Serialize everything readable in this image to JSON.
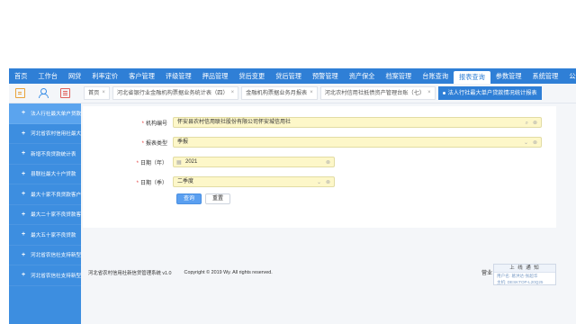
{
  "topnav": {
    "items": [
      "首页",
      "工作台",
      "网贷",
      "利率定价",
      "客户管理",
      "评级管理",
      "押品管理",
      "贷后变更",
      "贷后管理",
      "预警管理",
      "资产保全",
      "档案管理",
      "台账查询",
      "报表查询",
      "参数管理",
      "系统管理",
      "公示事项"
    ],
    "active_label": "报表查询"
  },
  "iconbar": {
    "icons": [
      "document-icon",
      "user-icon",
      "list-icon"
    ]
  },
  "tabs": [
    {
      "label": "首页"
    },
    {
      "label": "河北省银行业金融机构票据业务统计表（四）"
    },
    {
      "label": "金融机构票据业务月报表"
    },
    {
      "label": "河北农村信用社抵债资产管理台账（七）"
    },
    {
      "label": "法人行社最大单户贷款情况统计报表"
    }
  ],
  "sidebar": {
    "items": [
      "法人行社最大单户贷款情况",
      "河北省农村信用社最大",
      "新增不良贷款统计表",
      "县联社最大十户贷款",
      "最大十家不良贷款客户",
      "最大二十家不良贷款客户",
      "最大五十家不良贷款",
      "河北省农信社支持新型",
      "河北省农信社支持新型"
    ]
  },
  "form": {
    "org_code_label": "机构编号",
    "org_code_value": "怀安县农村信用联社股份有限公司怀安城信用社",
    "report_type_label": "报表类型",
    "report_type_value": "季报",
    "date_year_label": "日期（年）",
    "date_year_value": "2021",
    "date_quarter_label": "日期（季）",
    "date_quarter_value": "二季度",
    "query_button": "查询",
    "reset_button": "重置"
  },
  "footer": {
    "system_name": "河北省农村信用社新信贷管理系统 v1.0",
    "copyright": "Copyright © 2019 Wy. All rights reserved.",
    "right_text": "营业"
  },
  "notice": {
    "title": "上 线 通 知",
    "line1": "用户名: 葛洪达-张超华",
    "line2": "主机: DESKTOP-L20Q25"
  },
  "colors": {
    "nav_blue": "#2f7fd6",
    "sidebar_blue": "#3d8ee0",
    "field_yellow": "#fdf7c9",
    "required_red": "#e23b3b"
  }
}
